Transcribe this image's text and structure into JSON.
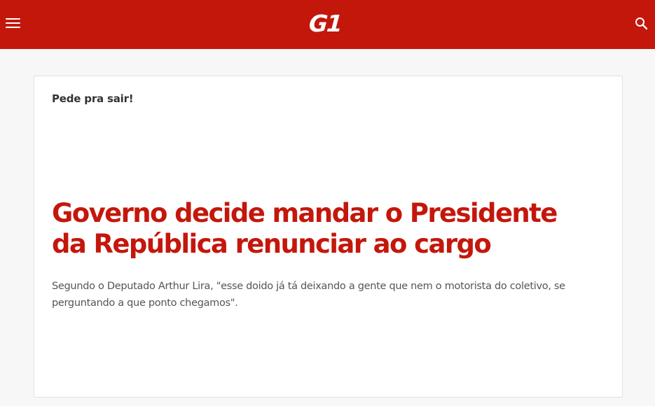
{
  "header": {
    "logo_text": "G1",
    "brand_color": "#c4170c",
    "menu_icon": "hamburger-menu-icon",
    "search_icon": "search-icon"
  },
  "article": {
    "kicker": "Pede pra sair!",
    "headline": "Governo decide mandar o Presidente da República renunciar ao cargo",
    "summary": "Segundo o Deputado Arthur Lira, \"esse doido já tá deixando a gente que nem o motorista do coletivo, se perguntando a que ponto chegamos\".",
    "headline_color": "#c4170c"
  }
}
